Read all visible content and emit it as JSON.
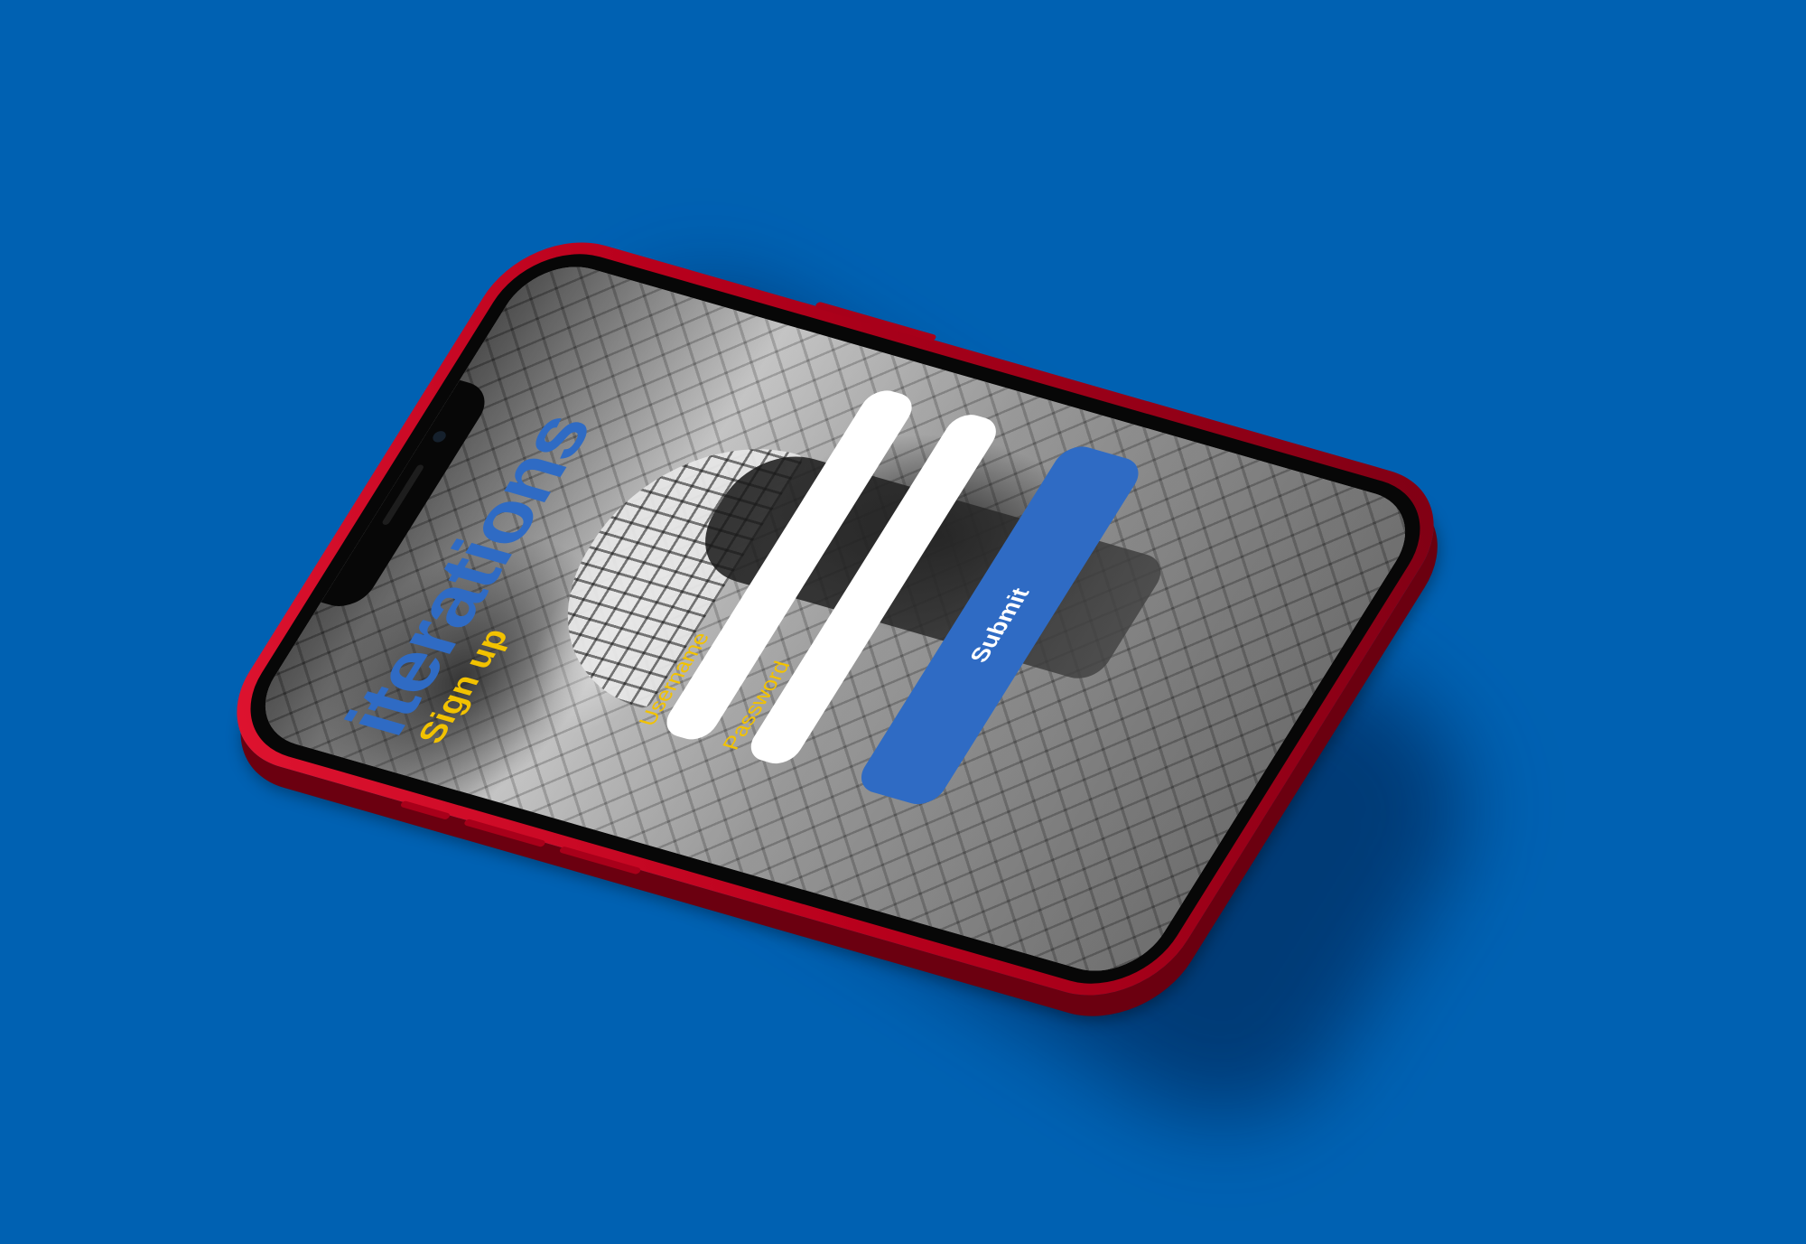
{
  "brand": {
    "name": "iterations"
  },
  "signup": {
    "title": "Sign up",
    "username_label": "Username",
    "password_label": "Password",
    "username_value": "",
    "password_value": "",
    "submit_label": "Submit"
  },
  "colors": {
    "background": "#0061b2",
    "phone_body": "#c8001e",
    "brand_blue": "#2f6bc4",
    "label_yellow": "#f2c200",
    "field_white": "#ffffff"
  }
}
